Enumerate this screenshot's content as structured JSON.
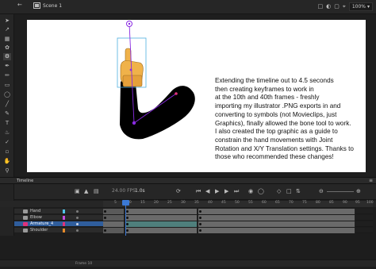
{
  "app": {
    "scene_label": "Scene 1",
    "zoom_value": "100%"
  },
  "stage": {
    "caption_lines": [
      "Extending the timeline out to 4.5 seconds",
      "then creating keyframes to work in",
      "at the 10th and 40th frames  - freshly",
      "importing my illustrator .PNG exports in and",
      "converting to symbols (not Movieclips, just",
      "Graphics), finally allowed the bone tool to work.",
      "I also created the top graphic as a guide to",
      "constrain the hand movements with Joint",
      "Rotation and X/Y Translation settings. Thanks to",
      "those who recommended these changes!"
    ]
  },
  "timeline": {
    "panel_title": "Timeline",
    "fps": "24.00",
    "fps_unit": "FPS",
    "seconds": "1.0",
    "seconds_unit": "s",
    "ruler_ticks": [
      "5",
      "10",
      "15",
      "20",
      "25",
      "30",
      "35",
      "40",
      "45",
      "50",
      "55",
      "60",
      "65",
      "70",
      "75",
      "80",
      "85",
      "90",
      "95",
      "100"
    ],
    "layers": [
      {
        "name": "Hand",
        "color": "#4fc3e8",
        "selected": false
      },
      {
        "name": "Elbow",
        "color": "#c64ee0",
        "selected": false
      },
      {
        "name": "Armature_4",
        "color": "#e0317a",
        "selected": true
      },
      {
        "name": "Shoulder",
        "color": "#e58a2a",
        "selected": false
      }
    ],
    "frame_label": "Frame 10"
  },
  "colors": {
    "bone_line": "#8a2be2",
    "bounding_box": "#4fb0e0",
    "selection": "#2f5d9c",
    "playhead": "#3b79d6",
    "tween_span": "#4f7f7c"
  }
}
